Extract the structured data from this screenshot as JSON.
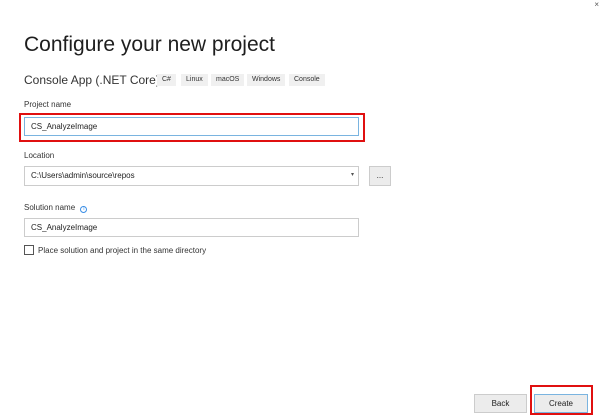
{
  "title": "Configure your new project",
  "template": {
    "name": "Console App (.NET Core)",
    "tags": [
      "C#",
      "Linux",
      "macOS",
      "Windows",
      "Console"
    ]
  },
  "project_name": {
    "label": "Project name",
    "value": "CS_AnalyzeImage"
  },
  "location": {
    "label": "Location",
    "value": "C:\\Users\\admin\\source\\repos",
    "browse_label": "..."
  },
  "solution_name": {
    "label": "Solution name",
    "value": "CS_AnalyzeImage"
  },
  "same_directory": {
    "label": "Place solution and project in the same directory",
    "checked": false
  },
  "buttons": {
    "back": "Back",
    "create": "Create"
  },
  "colors": {
    "highlight": "#e01010",
    "focus": "#7ab4e0"
  }
}
